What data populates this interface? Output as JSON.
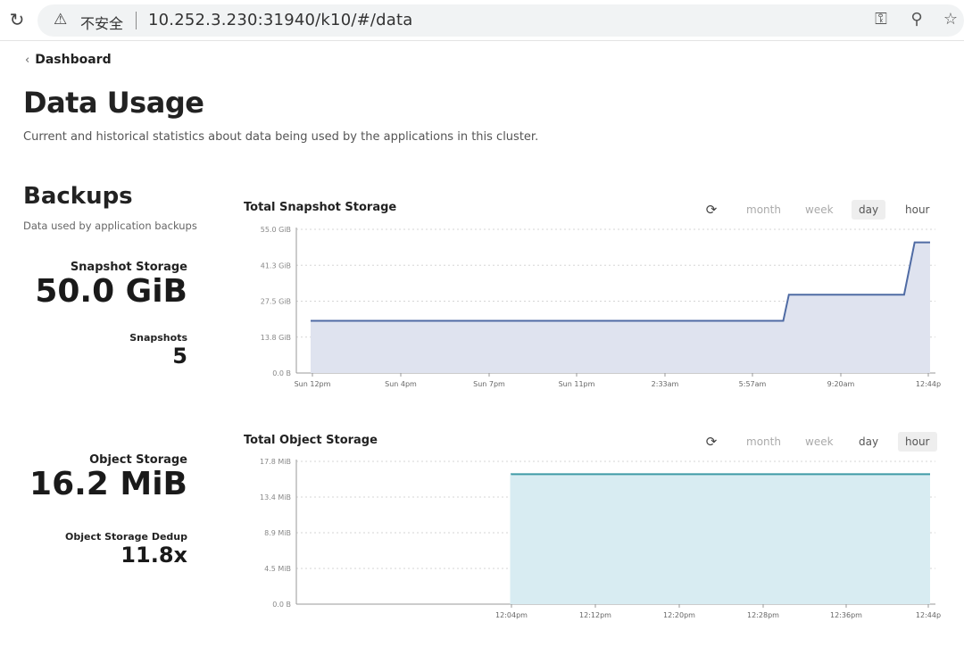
{
  "browser": {
    "insecure_label": "不安全",
    "url": "10.252.3.230:31940/k10/#/data",
    "icons": [
      "reload-icon",
      "warning-icon",
      "key-icon",
      "zoom-icon",
      "star-icon"
    ]
  },
  "nav": {
    "back_label": "Dashboard"
  },
  "page": {
    "title": "Data Usage",
    "subtitle": "Current and historical statistics about data being used by the applications in this cluster."
  },
  "backups": {
    "title": "Backups",
    "subtitle": "Data used by application backups",
    "snapshot_storage_label": "Snapshot Storage",
    "snapshot_storage_value": "50.0 GiB",
    "snapshots_label": "Snapshots",
    "snapshots_value": "5",
    "object_storage_label": "Object Storage",
    "object_storage_value": "16.2 MiB",
    "dedup_label": "Object Storage Dedup",
    "dedup_value": "11.8x"
  },
  "range_options": [
    "month",
    "week",
    "day",
    "hour"
  ],
  "colors": {
    "snapshot_line": "#4f6ba4",
    "snapshot_fill": "#dfe3ef",
    "object_line": "#3e9aa6",
    "object_fill": "#d8ecf2"
  },
  "chart_data": [
    {
      "type": "area",
      "title": "Total Snapshot Storage",
      "selected_range": "day",
      "y_ticks": [
        "0.0 B",
        "13.8 GiB",
        "27.5 GiB",
        "41.3 GiB",
        "55.0 GiB"
      ],
      "ylim": [
        0,
        55
      ],
      "y_unit": "GiB",
      "x_ticks": [
        "Sun 12pm",
        "Sun 4pm",
        "Sun 7pm",
        "Sun 11pm",
        "2:33am",
        "5:57am",
        "9:20am",
        "12:44p"
      ],
      "points": [
        [
          0.0,
          20.0
        ],
        [
          0.763,
          20.0
        ],
        [
          0.772,
          30.0
        ],
        [
          0.958,
          30.0
        ],
        [
          0.975,
          50.0
        ],
        [
          1.0,
          50.0
        ]
      ],
      "grid": true,
      "step": true
    },
    {
      "type": "area",
      "title": "Total Object Storage",
      "selected_range": "hour",
      "y_ticks": [
        "0.0 B",
        "4.5 MiB",
        "8.9 MiB",
        "13.4 MiB",
        "17.8 MiB"
      ],
      "ylim": [
        0,
        17.8
      ],
      "y_unit": "MiB",
      "x_ticks": [
        "12:04pm",
        "12:12pm",
        "12:20pm",
        "12:28pm",
        "12:36pm",
        "12:44p"
      ],
      "points": [
        [
          0.0,
          16.2
        ],
        [
          1.0,
          16.2
        ]
      ],
      "grid": true,
      "step": false
    }
  ]
}
